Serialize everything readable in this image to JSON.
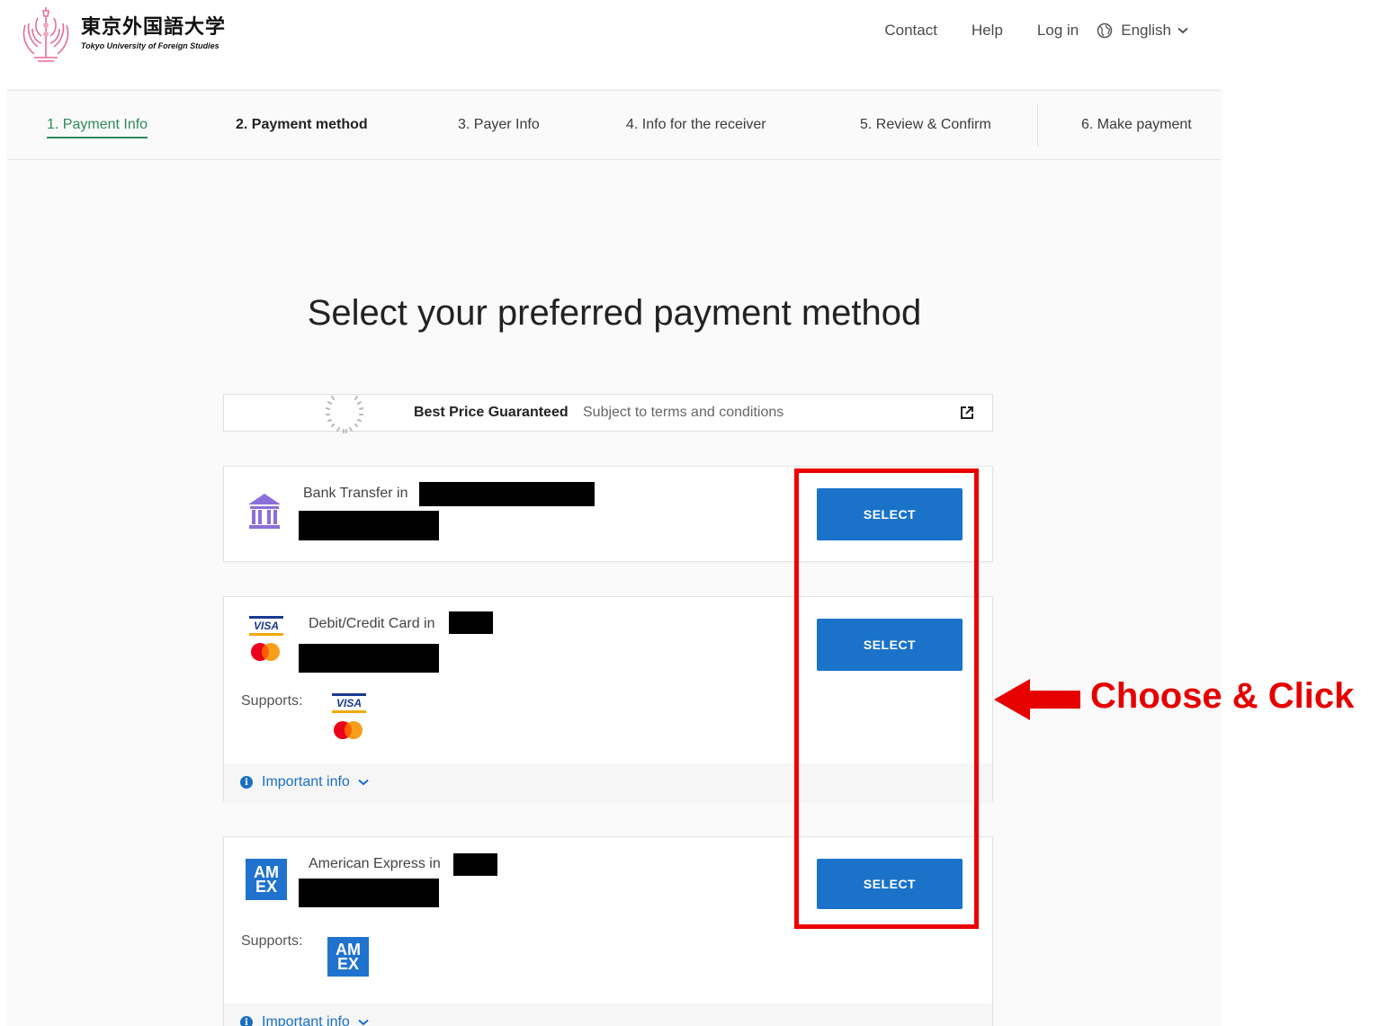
{
  "header": {
    "logo_jp": "東京外国語大学",
    "logo_en": "Tokyo University of Foreign Studies",
    "nav": {
      "contact": "Contact",
      "help": "Help",
      "login": "Log in",
      "language": "English"
    }
  },
  "steps": [
    {
      "label": "1. Payment Info",
      "state": "done"
    },
    {
      "label": "2. Payment method",
      "state": "active"
    },
    {
      "label": "3. Payer Info",
      "state": "pending"
    },
    {
      "label": "4. Info for the receiver",
      "state": "pending"
    },
    {
      "label": "5. Review & Confirm",
      "state": "pending"
    },
    {
      "label": "6. Make payment",
      "state": "pending"
    }
  ],
  "main": {
    "title": "Select your preferred payment method",
    "banner": {
      "strong": "Best Price Guaranteed",
      "sub": "Subject to terms and conditions"
    },
    "methods": [
      {
        "label": "Bank Transfer in",
        "button": "SELECT",
        "icon": "bank-icon"
      },
      {
        "label": "Debit/Credit Card in",
        "button": "SELECT",
        "icon": "visa-mastercard-icon",
        "supports_label": "Supports:",
        "info": "Important info"
      },
      {
        "label": "American Express in",
        "button": "SELECT",
        "icon": "amex-icon",
        "supports_label": "Supports:",
        "info": "Important info"
      }
    ],
    "card_logos": {
      "visa": "VISA",
      "amex_line1": "AM",
      "amex_line2": "EX"
    }
  },
  "annotation": {
    "text": "Choose & Click",
    "color": "#e60000"
  },
  "colors": {
    "primary": "#1a73c9",
    "done_step": "#2c8a5a",
    "bank_icon": "#8b6fd9"
  }
}
